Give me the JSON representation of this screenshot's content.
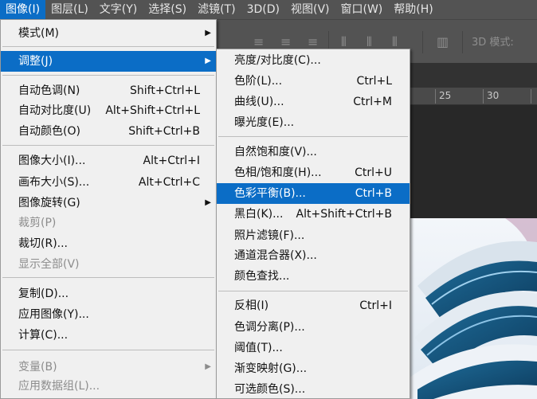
{
  "menubar": {
    "items": [
      {
        "label": "图像(I)",
        "active": true
      },
      {
        "label": "图层(L)"
      },
      {
        "label": "文字(Y)"
      },
      {
        "label": "选择(S)"
      },
      {
        "label": "滤镜(T)"
      },
      {
        "label": "3D(D)"
      },
      {
        "label": "视图(V)"
      },
      {
        "label": "窗口(W)"
      },
      {
        "label": "帮助(H)"
      }
    ]
  },
  "options_bar": {
    "mode_label": "3D 模式:"
  },
  "ruler": {
    "numbers": [
      "25",
      "30"
    ]
  },
  "image_menu": {
    "items": [
      {
        "label": "模式(M)",
        "submenu": true
      },
      {
        "label": "调整(J)",
        "submenu": true,
        "highlighted": true
      },
      {
        "label": "自动色调(N)",
        "shortcut": "Shift+Ctrl+L"
      },
      {
        "label": "自动对比度(U)",
        "shortcut": "Alt+Shift+Ctrl+L"
      },
      {
        "label": "自动颜色(O)",
        "shortcut": "Shift+Ctrl+B"
      },
      {
        "label": "图像大小(I)...",
        "shortcut": "Alt+Ctrl+I"
      },
      {
        "label": "画布大小(S)...",
        "shortcut": "Alt+Ctrl+C"
      },
      {
        "label": "图像旋转(G)",
        "submenu": true
      },
      {
        "label": "裁剪(P)",
        "disabled": true
      },
      {
        "label": "裁切(R)..."
      },
      {
        "label": "显示全部(V)",
        "disabled": true
      },
      {
        "label": "复制(D)..."
      },
      {
        "label": "应用图像(Y)..."
      },
      {
        "label": "计算(C)..."
      },
      {
        "label": "变量(B)",
        "submenu": true,
        "disabled": true
      },
      {
        "label": "应用数据组(L)...",
        "disabled": true
      }
    ]
  },
  "adjust_submenu": {
    "items": [
      {
        "label": "亮度/对比度(C)..."
      },
      {
        "label": "色阶(L)...",
        "shortcut": "Ctrl+L"
      },
      {
        "label": "曲线(U)...",
        "shortcut": "Ctrl+M"
      },
      {
        "label": "曝光度(E)..."
      },
      {
        "label": "自然饱和度(V)..."
      },
      {
        "label": "色相/饱和度(H)...",
        "shortcut": "Ctrl+U"
      },
      {
        "label": "色彩平衡(B)...",
        "shortcut": "Ctrl+B",
        "highlighted": true
      },
      {
        "label": "黑白(K)...",
        "shortcut": "Alt+Shift+Ctrl+B"
      },
      {
        "label": "照片滤镜(F)..."
      },
      {
        "label": "通道混合器(X)..."
      },
      {
        "label": "颜色查找..."
      },
      {
        "label": "反相(I)",
        "shortcut": "Ctrl+I"
      },
      {
        "label": "色调分离(P)..."
      },
      {
        "label": "阈值(T)..."
      },
      {
        "label": "渐变映射(G)..."
      },
      {
        "label": "可选颜色(S)..."
      }
    ]
  },
  "icons": {
    "submenu_arrow": "triangle-right-icon"
  },
  "colors": {
    "highlight": "#0b6dc6",
    "menu_bg": "#f0f0f0",
    "menubar_bg": "#535353"
  }
}
